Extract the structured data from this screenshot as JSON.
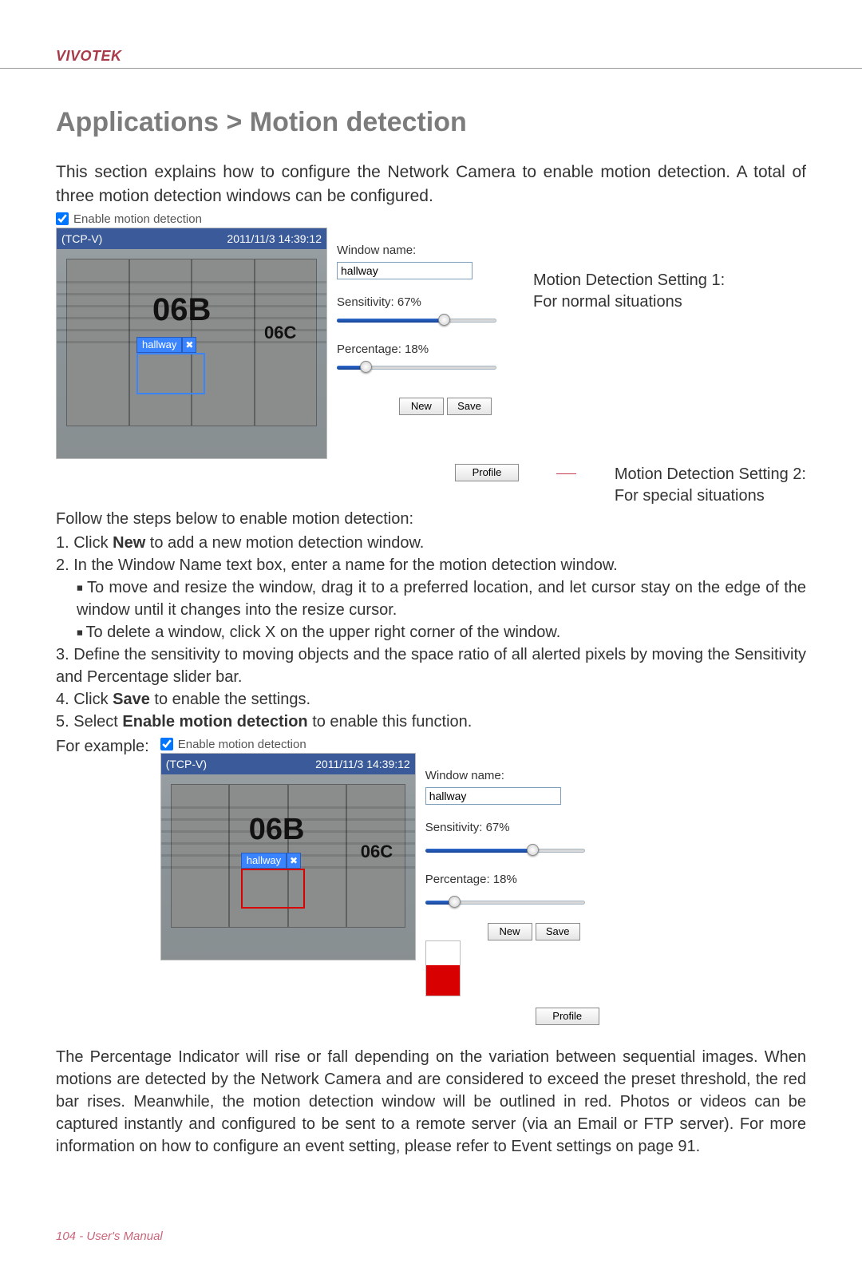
{
  "brand": "VIVOTEK",
  "heading": "Applications > Motion detection",
  "intro": "This section explains how to configure the Network Camera to enable motion detection. A total of three motion detection windows can be configured.",
  "enable_label": "Enable motion detection",
  "camera": {
    "source": "(TCP-V)",
    "timestamp": "2011/11/3 14:39:12",
    "unit_a": "06B",
    "unit_b": "06C"
  },
  "md_window": {
    "tag": "hallway",
    "close": "✖"
  },
  "form": {
    "window_name_label": "Window name:",
    "window_name_value": "hallway",
    "sensitivity_label": "Sensitivity: 67%",
    "percentage_label": "Percentage: 18%",
    "new_btn": "New",
    "save_btn": "Save"
  },
  "profile_btn": "Profile",
  "note1": {
    "title": "Motion Detection Setting 1:",
    "desc": "For normal situations"
  },
  "note2": {
    "title": "Motion Detection Setting 2:",
    "desc": "For special situations"
  },
  "follow": "Follow the steps below to enable motion detection:",
  "steps": {
    "s1a": "1. Click ",
    "s1b": "New",
    "s1c": " to add a new motion detection window.",
    "s2": "2. In the Window Name text box, enter a name for the motion detection window.",
    "s2a": "To move and resize the window, drag it to a preferred location, and let cursor stay on the edge of the window until it changes into the resize cursor.",
    "s2b": "To delete a window, click X on the upper right corner of the window.",
    "s3": "3. Define the sensitivity to moving objects and the space ratio of all alerted pixels by moving the Sensitivity and Percentage slider bar.",
    "s4a": "4. Click ",
    "s4b": "Save",
    "s4c": " to enable the settings.",
    "s5a": "5. Select ",
    "s5b": "Enable motion detection",
    "s5c": " to enable this function."
  },
  "example_label": "For example:",
  "para2": "The Percentage Indicator will rise or fall depending on the variation between sequential images. When motions are detected by the Network Camera and are considered to exceed the preset threshold, the red bar rises. Meanwhile, the motion detection window will be outlined in red. Photos or videos can be captured instantly and configured to be sent to a remote server (via an Email or FTP server). For more information on how to configure an event setting, please refer to Event settings on page 91.",
  "footer": "104 - User's Manual"
}
